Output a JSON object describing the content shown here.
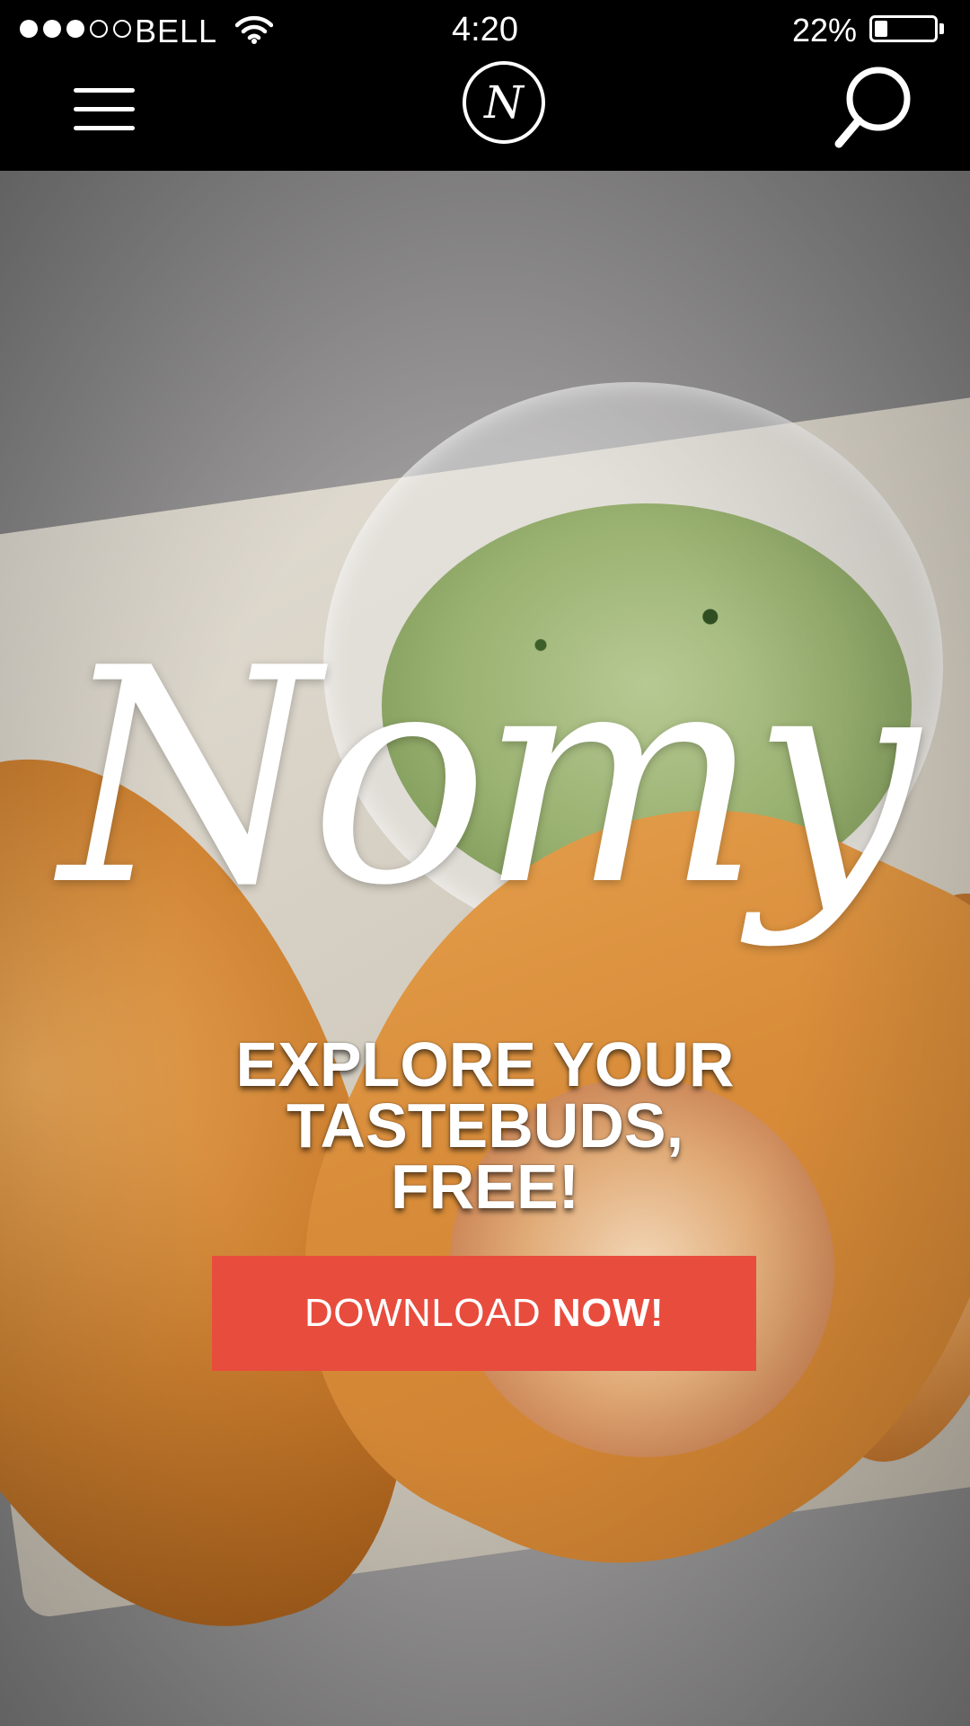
{
  "status_bar": {
    "signal": {
      "filled": 3,
      "total": 5
    },
    "carrier": "BELL",
    "time": "4:20",
    "battery_percent_label": "22%",
    "battery_level": 0.22
  },
  "nav": {
    "menu_icon": "hamburger-menu-icon",
    "logo_letter": "N",
    "search_icon": "magnifier-search-icon"
  },
  "hero": {
    "brand": "Nomy",
    "tagline_lines": [
      "EXPLORE YOUR",
      "TASTEBUDS,",
      "FREE!"
    ],
    "cta": {
      "label_regular": "DOWNLOAD ",
      "label_bold": "NOW!"
    },
    "colors": {
      "cta": "#e84c3d",
      "nav": "#000000",
      "text": "#ffffff"
    }
  }
}
